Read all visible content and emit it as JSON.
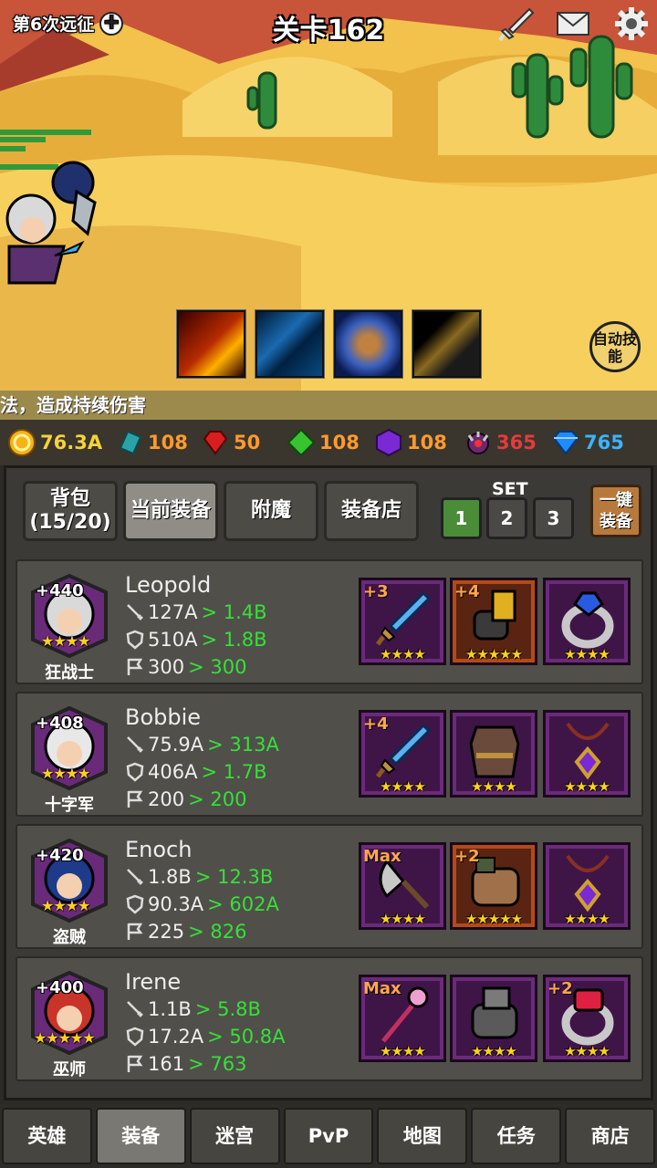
{
  "scene": {
    "expedition_label": "第6次远征",
    "stage_title": "关卡162",
    "auto_skill_label": "自动技能",
    "ticker_text": "法，造成持续伤害"
  },
  "icons": {
    "expedition_add": "plus-circle-icon",
    "sword": "sword-icon",
    "mail": "mail-icon",
    "settings": "gear-icon"
  },
  "currency": [
    {
      "name": "gold",
      "value": "76.3A",
      "color": "#f5d23a"
    },
    {
      "name": "teal-crystal",
      "value": "108",
      "color": "#ff9a2e"
    },
    {
      "name": "red-gem",
      "value": "50",
      "color": "#ff9a2e"
    },
    {
      "name": "green-gem",
      "value": "108",
      "color": "#ff9a2e"
    },
    {
      "name": "purple-gem",
      "value": "108",
      "color": "#ff9a2e"
    },
    {
      "name": "demon-orb",
      "value": "365",
      "color": "#e33c3c"
    },
    {
      "name": "diamond",
      "value": "765",
      "color": "#3ab4ff"
    }
  ],
  "tabs": [
    {
      "label": "背包\n(15/20)",
      "active": false
    },
    {
      "label": "当前装备",
      "active": true
    },
    {
      "label": "附魔",
      "active": false
    },
    {
      "label": "装备店",
      "active": false
    }
  ],
  "set": {
    "label": "SET",
    "buttons": [
      "1",
      "2",
      "3"
    ],
    "active": "1",
    "equip_all": "一键装备"
  },
  "heroes": [
    {
      "name": "Leopold",
      "class": "狂战士",
      "level_bonus": "+440",
      "stars": 4,
      "attack": "127A",
      "attack_next": "> 1.4B",
      "defense": "510A",
      "defense_next": "> 1.8B",
      "flag": "300",
      "flag_next": "> 300",
      "gear": [
        {
          "item": "sword",
          "plus": "+3",
          "stars": 4,
          "rarity": "purple"
        },
        {
          "item": "gauntlet",
          "plus": "+4",
          "stars": 5,
          "rarity": "orange"
        },
        {
          "item": "ring-sapphire",
          "plus": "",
          "stars": 4,
          "rarity": "purple"
        }
      ]
    },
    {
      "name": "Bobbie",
      "class": "十字军",
      "level_bonus": "+408",
      "stars": 4,
      "attack": "75.9A",
      "attack_next": "> 313A",
      "defense": "406A",
      "defense_next": "> 1.7B",
      "flag": "200",
      "flag_next": "> 200",
      "gear": [
        {
          "item": "sword",
          "plus": "+4",
          "stars": 4,
          "rarity": "purple"
        },
        {
          "item": "armor",
          "plus": "",
          "stars": 4,
          "rarity": "purple"
        },
        {
          "item": "amulet",
          "plus": "",
          "stars": 4,
          "rarity": "purple"
        }
      ]
    },
    {
      "name": "Enoch",
      "class": "盗贼",
      "level_bonus": "+420",
      "stars": 4,
      "attack": "1.8B",
      "attack_next": "> 12.3B",
      "defense": "90.3A",
      "defense_next": "> 602A",
      "flag": "225",
      "flag_next": "> 826",
      "gear": [
        {
          "item": "axe",
          "plus": "Max",
          "stars": 4,
          "rarity": "purple"
        },
        {
          "item": "gloves",
          "plus": "+2",
          "stars": 5,
          "rarity": "orange"
        },
        {
          "item": "amulet",
          "plus": "",
          "stars": 4,
          "rarity": "purple"
        }
      ]
    },
    {
      "name": "Irene",
      "class": "巫师",
      "level_bonus": "+400",
      "stars": 5,
      "attack": "1.1B",
      "attack_next": "> 5.8B",
      "defense": "17.2A",
      "defense_next": "> 50.8A",
      "flag": "161",
      "flag_next": "> 763",
      "gear": [
        {
          "item": "staff",
          "plus": "Max",
          "stars": 4,
          "rarity": "purple"
        },
        {
          "item": "gauntlet-steel",
          "plus": "",
          "stars": 4,
          "rarity": "purple"
        },
        {
          "item": "ring-ruby",
          "plus": "+2",
          "stars": 4,
          "rarity": "purple"
        }
      ]
    }
  ],
  "bottom_nav": [
    {
      "label": "英雄",
      "active": false
    },
    {
      "label": "装备",
      "active": true
    },
    {
      "label": "迷宫",
      "active": false
    },
    {
      "label": "PvP",
      "active": false
    },
    {
      "label": "地图",
      "active": false
    },
    {
      "label": "任务",
      "active": false
    },
    {
      "label": "商店",
      "active": false
    }
  ]
}
